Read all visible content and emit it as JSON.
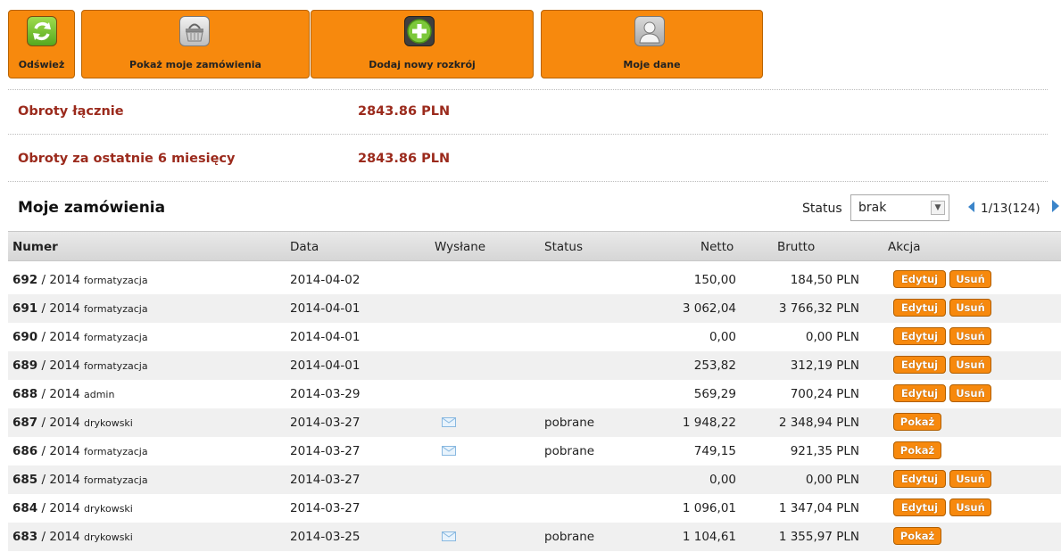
{
  "toolbar": {
    "refresh_label": "Odśwież",
    "orders_label": "Pokaż moje zamówienia",
    "add_label": "Dodaj nowy rozkrój",
    "mydata_label": "Moje dane"
  },
  "totals": {
    "total_label": "Obroty łącznie",
    "total_value": "2843.86 PLN",
    "six_months_label": "Obroty za ostatnie 6 miesięcy",
    "six_months_value": "2843.86 PLN"
  },
  "orders_section": {
    "title": "Moje zamówienia",
    "status_label": "Status",
    "status_value": "brak",
    "pager": "1/13(124)"
  },
  "table": {
    "headers": [
      "Numer",
      "Data",
      "Wysłane",
      "Status",
      "Netto",
      "Brutto",
      "Akcja"
    ],
    "edit_label": "Edytuj",
    "delete_label": "Usuń",
    "show_label": "Pokaż",
    "rows": [
      {
        "num": "692",
        "year": "/ 2014",
        "user": "formatyzacja",
        "date": "2014-04-02",
        "sent": false,
        "status": "",
        "netto": "150,00",
        "brutto": "184,50 PLN",
        "actions": "edit"
      },
      {
        "num": "691",
        "year": "/ 2014",
        "user": "formatyzacja",
        "date": "2014-04-01",
        "sent": false,
        "status": "",
        "netto": "3 062,04",
        "brutto": "3 766,32 PLN",
        "actions": "edit"
      },
      {
        "num": "690",
        "year": "/ 2014",
        "user": "formatyzacja",
        "date": "2014-04-01",
        "sent": false,
        "status": "",
        "netto": "0,00",
        "brutto": "0,00 PLN",
        "actions": "edit"
      },
      {
        "num": "689",
        "year": "/ 2014",
        "user": "formatyzacja",
        "date": "2014-04-01",
        "sent": false,
        "status": "",
        "netto": "253,82",
        "brutto": "312,19 PLN",
        "actions": "edit"
      },
      {
        "num": "688",
        "year": "/ 2014",
        "user": "admin",
        "date": "2014-03-29",
        "sent": false,
        "status": "",
        "netto": "569,29",
        "brutto": "700,24 PLN",
        "actions": "edit"
      },
      {
        "num": "687",
        "year": "/ 2014",
        "user": "drykowski",
        "date": "2014-03-27",
        "sent": true,
        "status": "pobrane",
        "netto": "1 948,22",
        "brutto": "2 348,94 PLN",
        "actions": "show"
      },
      {
        "num": "686",
        "year": "/ 2014",
        "user": "formatyzacja",
        "date": "2014-03-27",
        "sent": true,
        "status": "pobrane",
        "netto": "749,15",
        "brutto": "921,35 PLN",
        "actions": "show"
      },
      {
        "num": "685",
        "year": "/ 2014",
        "user": "formatyzacja",
        "date": "2014-03-27",
        "sent": false,
        "status": "",
        "netto": "0,00",
        "brutto": "0,00 PLN",
        "actions": "edit"
      },
      {
        "num": "684",
        "year": "/ 2014",
        "user": "drykowski",
        "date": "2014-03-27",
        "sent": false,
        "status": "",
        "netto": "1 096,01",
        "brutto": "1 347,04 PLN",
        "actions": "edit"
      },
      {
        "num": "683",
        "year": "/ 2014",
        "user": "drykowski",
        "date": "2014-03-25",
        "sent": true,
        "status": "pobrane",
        "netto": "1 104,61",
        "brutto": "1 355,97 PLN",
        "actions": "show"
      }
    ]
  },
  "colors": {
    "accent": "#f7890d",
    "totals_text": "#9b2a1c",
    "link_blue": "#3a84c9"
  },
  "icons": {
    "refresh": "refresh-icon",
    "orders": "basket-icon",
    "add": "plus-icon",
    "mydata": "user-icon",
    "sent": "envelope-icon"
  }
}
